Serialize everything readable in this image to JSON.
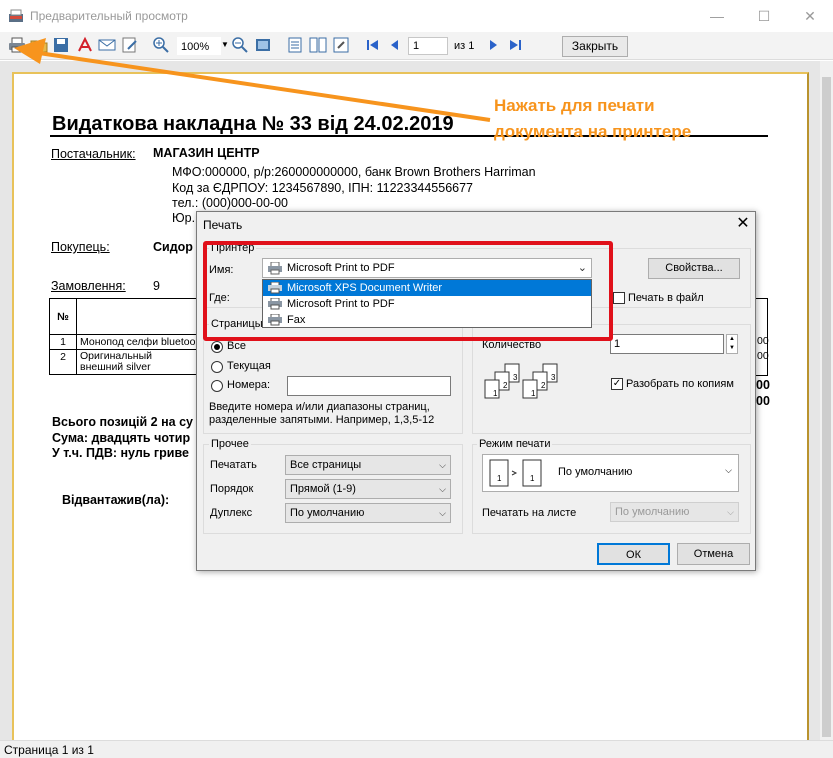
{
  "window": {
    "title": "Предварительный просмотр"
  },
  "toolbar": {
    "zoom": "100%",
    "page_current": "1",
    "page_of": "из 1",
    "close_label": "Закрыть",
    "icons": [
      "print-icon",
      "open-icon",
      "save-icon",
      "pdf-icon",
      "email-icon",
      "edit-icon",
      "zoom-in-icon",
      "zoom-out-icon",
      "fit-page-icon",
      "single-page-icon",
      "two-pages-icon",
      "settings-icon",
      "first-page-icon",
      "prev-page-icon",
      "next-page-icon",
      "last-page-icon"
    ]
  },
  "document": {
    "title": "Видаткова накладна № 33 від 24.02.2019",
    "supplier_label": "Постачальник:",
    "supplier_name": "МАГАЗИН ЦЕНТР",
    "supplier_bank": "МФО:000000, р/р:260000000000, банк Brown Brothers Harriman",
    "supplier_codes": "Код за ЄДРПОУ: 1234567890, ІПН: 11223344556677",
    "supplier_phone": "тел.: (000)000-00-00",
    "supplier_addr": "Юр.",
    "buyer_label": "Покупець:",
    "buyer_name": "Сидор",
    "order_label": "Замовлення:",
    "order_value": "9",
    "table_header": "№",
    "rows": [
      {
        "n": "1",
        "name": "Монопод селфи bluetoo"
      },
      {
        "n": "2",
        "name": "Оригинальный внешний silver"
      }
    ],
    "total_positions": "Всього позицій 2 на су",
    "total_sum": "Сума: двадцять чотир",
    "total_vat": "У т.ч. ПДВ: нуль гриве",
    "shipped": "Відвантажив(ла):",
    "right_num_1": "00",
    "right_num_2": "00",
    "right_cut_1": "00",
    "right_cut_2": "00"
  },
  "annotation": {
    "line1": "Нажать для печати",
    "line2": "документа на принтере",
    "color": "#f7941d"
  },
  "dialog": {
    "title": "Печать",
    "printer_group": "Принтер",
    "name_label": "Имя:",
    "printer_selected": "Microsoft Print to PDF",
    "properties_button": "Свойства...",
    "where_label": "Где:",
    "print_to_file": "Печать в файл",
    "pages_group": "Страницы",
    "pages_all": "Все",
    "pages_current": "Текущая",
    "pages_numbers": "Номера:",
    "pages_hint_1": "Введите номера и/или диапазоны страниц,",
    "pages_hint_2": "разделенные запятыми. Например, 1,3,5-12",
    "copies_label": "Количество",
    "copies_value": "1",
    "collate_label": "Разобрать по копиям",
    "other_group": "Прочее",
    "print_label": "Печатать",
    "print_value": "Все страницы",
    "order_label": "Порядок",
    "order_value": "Прямой (1-9)",
    "duplex_label": "Дуплекс",
    "duplex_value": "По умолчанию",
    "mode_group": "Режим печати",
    "mode_value": "По умолчанию",
    "per_sheet_label": "Печатать на листе",
    "per_sheet_value": "По умолчанию",
    "ok": "ОК",
    "cancel": "Отмена",
    "dropdown_items": [
      "Microsoft XPS Document Writer",
      "Microsoft Print to PDF",
      "Fax"
    ]
  },
  "status": {
    "text": "Страница 1 из 1"
  },
  "colors": {
    "highlight_box": "#e0101a",
    "selection": "#0078d7",
    "page_border": "#e8c25a"
  }
}
